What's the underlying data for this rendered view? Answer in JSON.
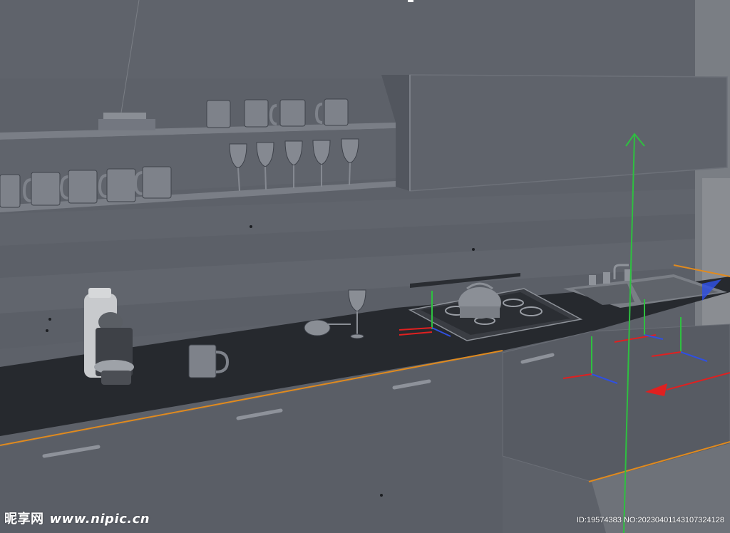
{
  "viewport": {
    "description_free": true,
    "colors": {
      "wall": "#5e636b",
      "shelf": "#6a6f77",
      "counter_top": "#26292e",
      "cabinet": "#5a5f67",
      "edge_highlight": "#e08a1e",
      "axis_x": "#e02020",
      "axis_y": "#2ec040",
      "axis_z": "#3050e0"
    },
    "icons": [
      "move-gizmo-y-arrow-icon",
      "move-gizmo-x-arrow-icon",
      "local-axis-icon"
    ]
  },
  "watermark": {
    "brand": "昵享网",
    "site": "www.nipic.cn",
    "id_text": "ID:19574383 NO:20230401143107324128"
  }
}
